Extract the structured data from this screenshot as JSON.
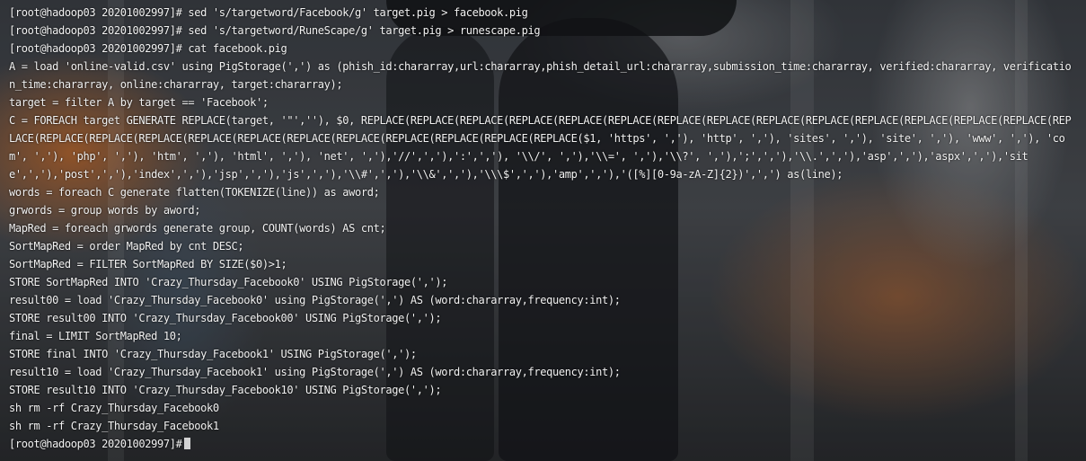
{
  "wallpaper": {
    "icon": "anime-rain-umbrella-wallpaper",
    "colors": {
      "orange_bokeh": "#d26e28",
      "dark_figure": "#141619",
      "base": "#3b3f45"
    }
  },
  "terminal": {
    "text_color": "#f2f2f2",
    "lines": [
      "[root@hadoop03 20201002997]# sed 's/targetword/Facebook/g' target.pig > facebook.pig",
      "[root@hadoop03 20201002997]# sed 's/targetword/RuneScape/g' target.pig > runescape.pig",
      "[root@hadoop03 20201002997]# cat facebook.pig",
      "A = load 'online-valid.csv' using PigStorage(',') as (phish_id:chararray,url:chararray,phish_detail_url:chararray,submission_time:chararray, verified:chararray, verification_time:chararray, online:chararray, target:chararray);",
      "target = filter A by target == 'Facebook';",
      "C = FOREACH target GENERATE REPLACE(target, '\"',''), $0, REPLACE(REPLACE(REPLACE(REPLACE(REPLACE(REPLACE(REPLACE(REPLACE(REPLACE(REPLACE(REPLACE(REPLACE(REPLACE(REPLACE(REPLACE(REPLACE(REPLACE(REPLACE(REPLACE(REPLACE(REPLACE(REPLACE(REPLACE(REPLACE(REPLACE(REPLACE($1, 'https', ','), 'http', ','), 'sites', ','), 'site', ','), 'www', ','), 'com', ','), 'php', ','), 'htm', ','), 'html', ','), 'net', ','),'//',','),':',','), '\\\\/', ','),'\\\\=', ','),'\\\\?', ','),';',','),'\\\\.',','),'asp',','),'aspx',','),'site',','),'post',','),'index',','),'jsp',','),'js',','),'\\\\#',','),'\\\\&',','),'\\\\\\$',','),'amp',','),'([%][0-9a-zA-Z]{2})',',') as(line);",
      "words = foreach C generate flatten(TOKENIZE(line)) as aword;",
      "grwords = group words by aword;",
      "MapRed = foreach grwords generate group, COUNT(words) AS cnt;",
      "SortMapRed = order MapRed by cnt DESC;",
      "SortMapRed = FILTER SortMapRed BY SIZE($0)>1;",
      "STORE SortMapRed INTO 'Crazy_Thursday_Facebook0' USING PigStorage(',');",
      "result00 = load 'Crazy_Thursday_Facebook0' using PigStorage(',') AS (word:chararray,frequency:int);",
      "STORE result00 INTO 'Crazy_Thursday_Facebook00' USING PigStorage(',');",
      "final = LIMIT SortMapRed 10;",
      "STORE final INTO 'Crazy_Thursday_Facebook1' USING PigStorage(',');",
      "result10 = load 'Crazy_Thursday_Facebook1' using PigStorage(',') AS (word:chararray,frequency:int);",
      "STORE result10 INTO 'Crazy_Thursday_Facebook10' USING PigStorage(',');",
      "sh rm -rf Crazy_Thursday_Facebook0",
      "sh rm -rf Crazy_Thursday_Facebook1",
      "[root@hadoop03 20201002997]#"
    ]
  }
}
